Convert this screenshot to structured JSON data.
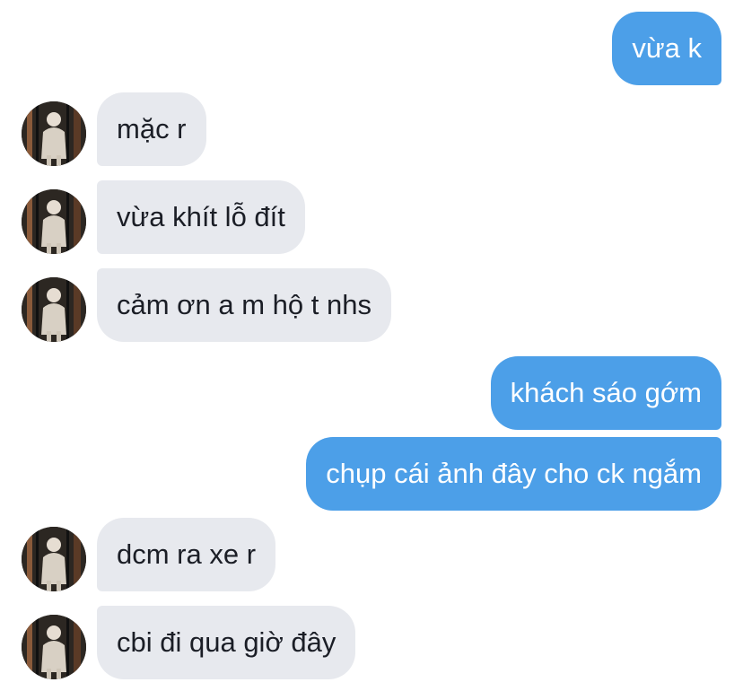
{
  "messages": [
    {
      "direction": "out",
      "text": "vừa k"
    },
    {
      "direction": "in",
      "text": "mặc r"
    },
    {
      "direction": "in",
      "text": "vừa khít lỗ đít"
    },
    {
      "direction": "in",
      "text": "cảm ơn a m hộ t nhs"
    },
    {
      "direction": "out",
      "text": "khách sáo gớm"
    },
    {
      "direction": "out",
      "text": "chụp cái ảnh đây cho ck ngắm"
    },
    {
      "direction": "in",
      "text": "dcm ra xe r"
    },
    {
      "direction": "in",
      "text": "cbi đi qua giờ đây"
    }
  ],
  "colors": {
    "outgoing": "#4c9fe8",
    "incoming": "#e7e9ee",
    "incoming_text": "#1b1e26"
  },
  "icons": {
    "contact_avatar": "contact-avatar-photo"
  }
}
